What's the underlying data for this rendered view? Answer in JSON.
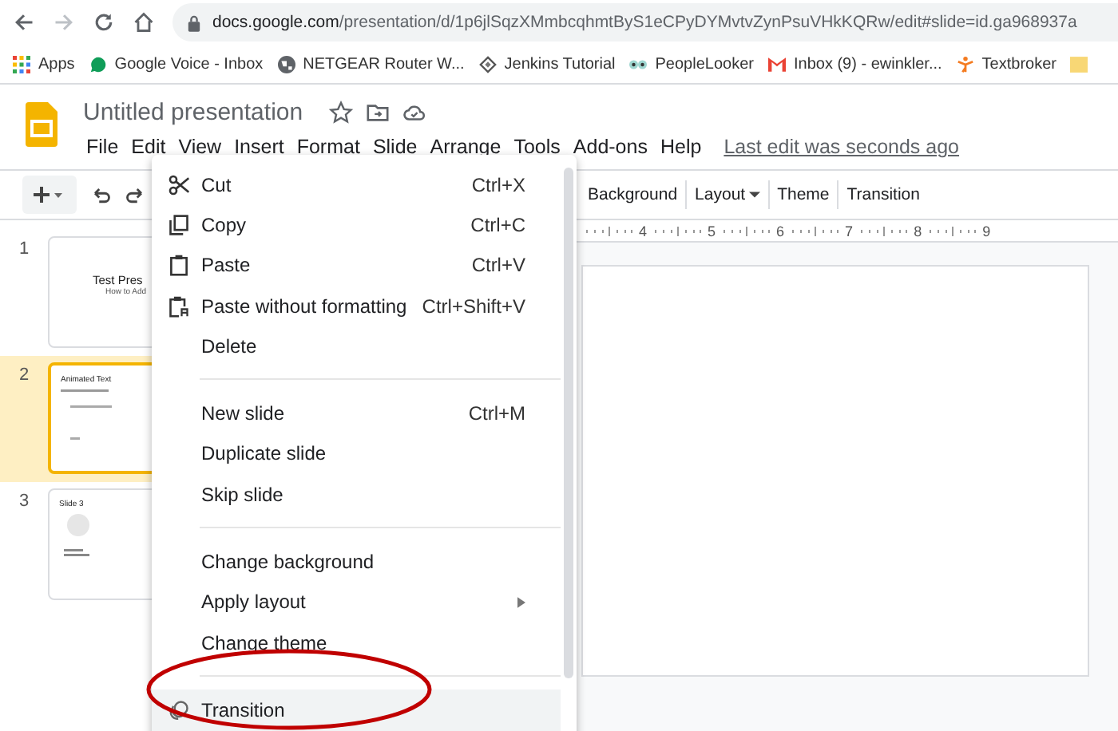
{
  "browser": {
    "url_domain": "docs.google.com",
    "url_path": "/presentation/d/1p6jlSqzXMmbcqhmtByS1eCPyDYMvtvZynPsuVHkKQRw/edit#slide=id.ga968937a",
    "bookmarks": [
      {
        "label": "Apps"
      },
      {
        "label": "Google Voice - Inbox"
      },
      {
        "label": "NETGEAR Router W..."
      },
      {
        "label": "Jenkins Tutorial"
      },
      {
        "label": "PeopleLooker"
      },
      {
        "label": "Inbox (9) - ewinkler..."
      },
      {
        "label": "Textbroker"
      }
    ]
  },
  "doc": {
    "title": "Untitled presentation",
    "menus": [
      "File",
      "Edit",
      "View",
      "Insert",
      "Format",
      "Slide",
      "Arrange",
      "Tools",
      "Add-ons",
      "Help"
    ],
    "last_edit": "Last edit was seconds ago"
  },
  "toolbar": {
    "buttons": [
      {
        "label": "Background",
        "dropdown": false
      },
      {
        "label": "Layout",
        "dropdown": true
      },
      {
        "label": "Theme",
        "dropdown": false
      },
      {
        "label": "Transition",
        "dropdown": false
      }
    ]
  },
  "slides": [
    {
      "number": "1",
      "selected": false,
      "kind": "title",
      "title": "Test Pres",
      "subtitle": "How to Add"
    },
    {
      "number": "2",
      "selected": true,
      "kind": "text",
      "title": "Animated Text"
    },
    {
      "number": "3",
      "selected": false,
      "kind": "shape",
      "title": "Slide 3"
    }
  ],
  "ruler": [
    "4",
    "5",
    "6",
    "7",
    "8",
    "9"
  ],
  "context_menu": [
    {
      "kind": "item",
      "label": "Cut",
      "shortcut": "Ctrl+X",
      "selected": false
    },
    {
      "kind": "item",
      "label": "Copy",
      "shortcut": "Ctrl+C",
      "selected": false
    },
    {
      "kind": "item",
      "label": "Paste",
      "shortcut": "Ctrl+V",
      "selected": false
    },
    {
      "kind": "item",
      "label": "Paste without formatting",
      "shortcut": "Ctrl+Shift+V",
      "selected": false
    },
    {
      "kind": "item",
      "label": "Delete",
      "selected": false
    },
    {
      "kind": "divider"
    },
    {
      "kind": "item",
      "label": "New slide",
      "shortcut": "Ctrl+M",
      "selected": false
    },
    {
      "kind": "item",
      "label": "Duplicate slide",
      "selected": false
    },
    {
      "kind": "item",
      "label": "Skip slide",
      "selected": false
    },
    {
      "kind": "divider"
    },
    {
      "kind": "item",
      "label": "Change background",
      "selected": false
    },
    {
      "kind": "item",
      "label": "Apply layout",
      "submenu": true,
      "selected": false
    },
    {
      "kind": "item",
      "label": "Change theme",
      "selected": false
    },
    {
      "kind": "divider"
    },
    {
      "kind": "item",
      "label": "Transition",
      "selected": true
    }
  ],
  "annotation": {
    "kind": "ellipse",
    "color": "#c00000"
  }
}
